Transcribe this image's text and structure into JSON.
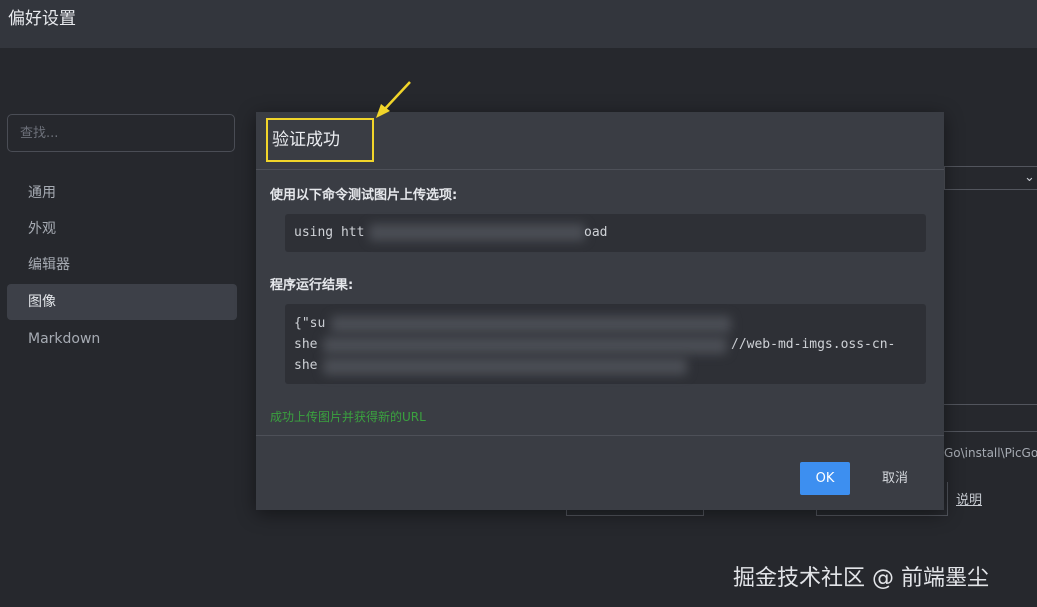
{
  "window": {
    "title": "偏好设置"
  },
  "sidebar": {
    "search_placeholder": "查找...",
    "items": [
      {
        "label": "通用"
      },
      {
        "label": "外观"
      },
      {
        "label": "编辑器"
      },
      {
        "label": "图像",
        "active": true
      },
      {
        "label": "Markdown"
      }
    ]
  },
  "background": {
    "path_text": "Go\\install\\PicGo",
    "help_link": "说明"
  },
  "dialog": {
    "title": "验证成功",
    "command_label": "使用以下命令测试图片上传选项:",
    "command_start": "using htt",
    "command_end": "oad",
    "result_label": "程序运行结果:",
    "result_line1": "{\"su",
    "result_line2_start": "she",
    "result_line2_end": "//web-md-imgs.oss-cn-",
    "result_line3_start": "she",
    "success_message": "成功上传图片并获得新的URL",
    "ok_label": "OK",
    "cancel_label": "取消"
  },
  "colors": {
    "highlight_border": "#f1d52a",
    "ok_button": "#3d8ff0",
    "success": "#3aa23f"
  },
  "watermark": "掘金技术社区 @ 前端墨尘"
}
